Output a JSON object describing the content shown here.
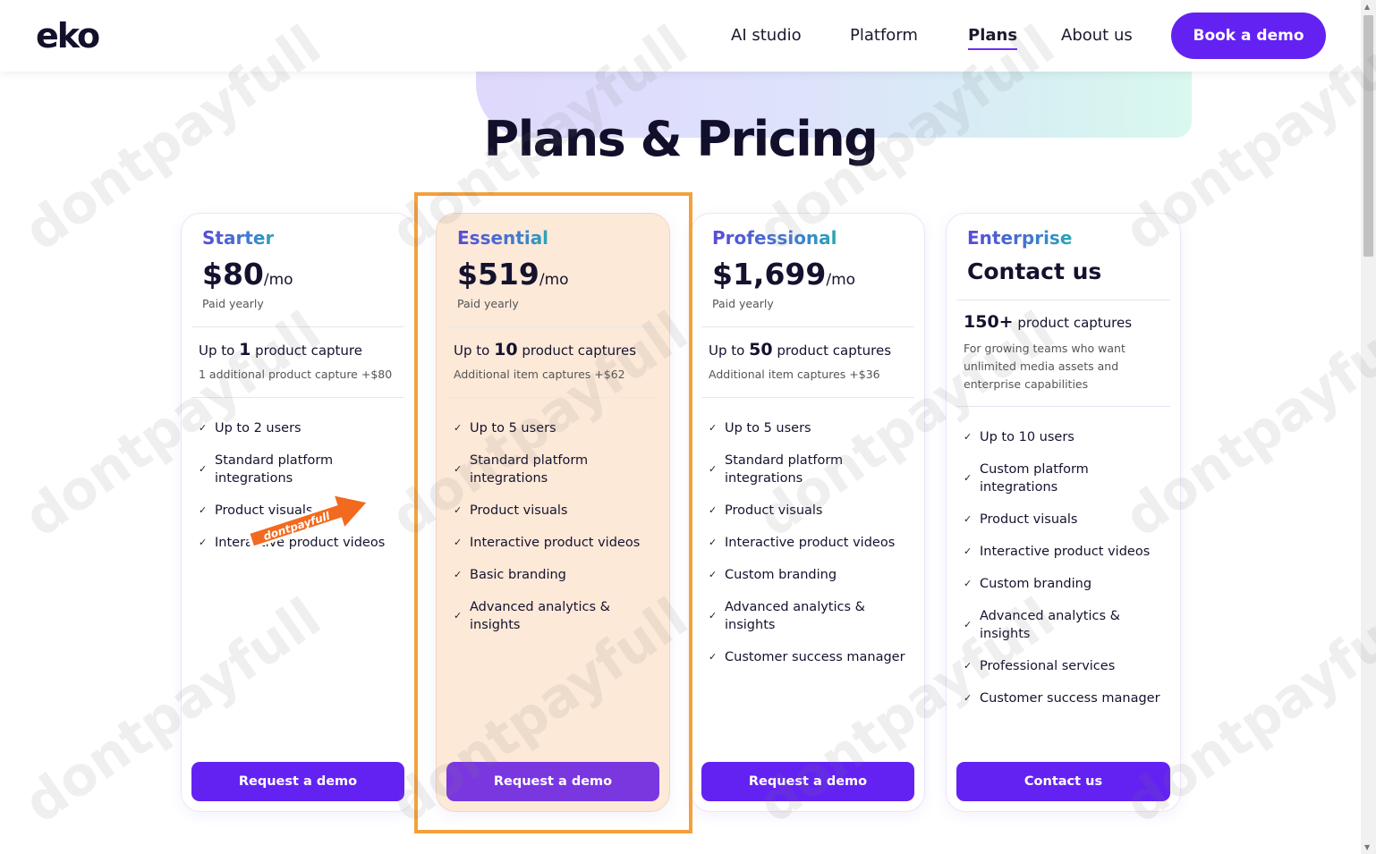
{
  "header": {
    "logo": "eko",
    "nav": [
      "AI studio",
      "Platform",
      "Plans",
      "About us"
    ],
    "active_nav": "Plans",
    "cta": "Book a demo"
  },
  "hero": {
    "title": "Plans & Pricing"
  },
  "plans": [
    {
      "name": "Starter",
      "price": "$80",
      "period": "/mo",
      "billing": "Paid yearly",
      "capture_prefix": "Up to",
      "capture_num": "1",
      "capture_suffix": "product capture",
      "capture_sub": "1 additional product capture +$80",
      "features": [
        "Up to 2 users",
        "Standard platform integrations",
        "Product visuals",
        "Interactive product videos"
      ],
      "button": "Request a demo"
    },
    {
      "name": "Essential",
      "price": "$519",
      "period": "/mo",
      "billing": "Paid yearly",
      "capture_prefix": "Up to",
      "capture_num": "10",
      "capture_suffix": "product captures",
      "capture_sub": "Additional item captures +$62",
      "features": [
        "Up to 5 users",
        "Standard platform integrations",
        "Product visuals",
        "Interactive product videos",
        "Basic branding",
        "Advanced analytics & insights"
      ],
      "button": "Request a demo"
    },
    {
      "name": "Professional",
      "price": "$1,699",
      "period": "/mo",
      "billing": "Paid yearly",
      "capture_prefix": "Up to",
      "capture_num": "50",
      "capture_suffix": "product captures",
      "capture_sub": "Additional item captures +$36",
      "features": [
        "Up to 5 users",
        "Standard platform integrations",
        "Product visuals",
        "Interactive product videos",
        "Custom branding",
        "Advanced analytics & insights",
        "Customer success manager"
      ],
      "button": "Request a demo"
    },
    {
      "name": "Enterprise",
      "contact_title": "Contact us",
      "capture_num": "150+",
      "capture_suffix": "product captures",
      "description": "For growing teams who want unlimited media assets and enterprise capabilities",
      "features": [
        "Up to 10 users",
        "Custom platform integrations",
        "Product visuals",
        "Interactive product videos",
        "Custom branding",
        "Advanced analytics & insights",
        "Professional services",
        "Customer success manager"
      ],
      "button": "Contact us"
    }
  ],
  "watermark": "dontpayfull",
  "icons": {
    "check": "check-icon",
    "arrow": "arrow-sticker-icon"
  },
  "colors": {
    "accent": "#6422f2",
    "highlight_bg": "#fde9d8",
    "highlight_border": "#f3a13a"
  }
}
